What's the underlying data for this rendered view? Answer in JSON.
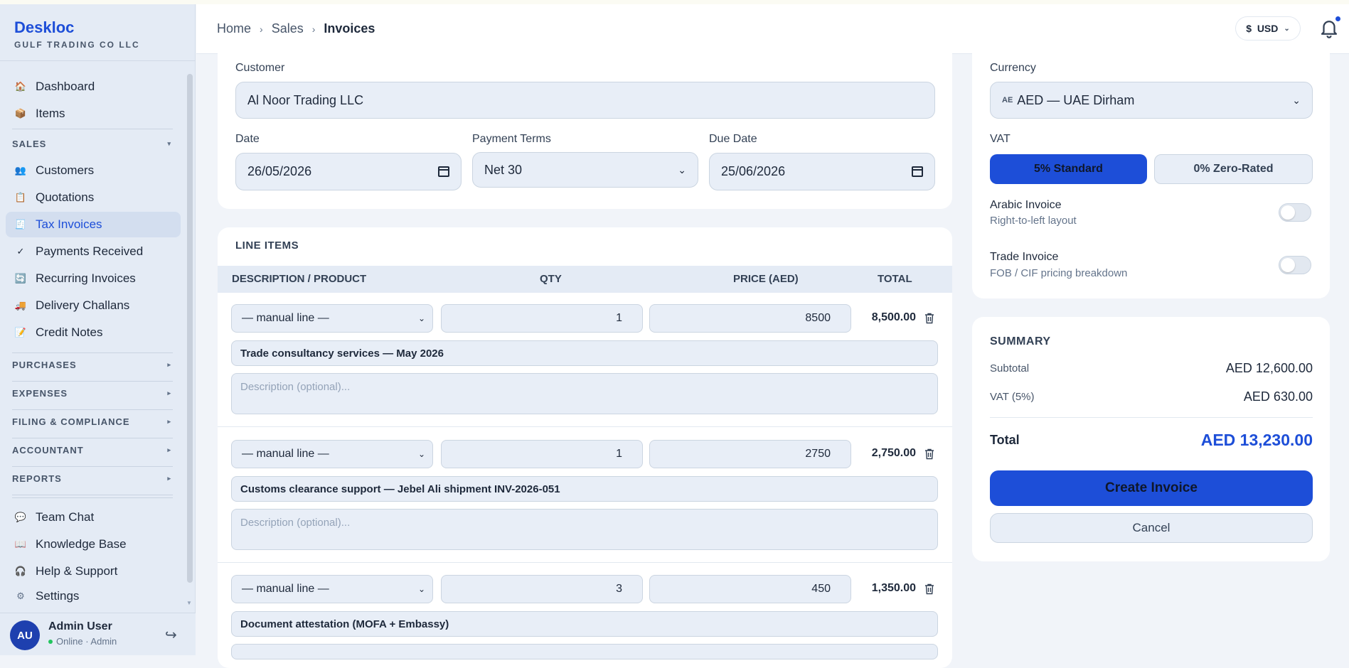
{
  "brand": {
    "name": "Deskloc",
    "company": "GULF TRADING CO LLC"
  },
  "sidebar": {
    "top_items": [
      {
        "label": "Dashboard",
        "icon": "house-icon"
      },
      {
        "label": "Items",
        "icon": "box-icon"
      }
    ],
    "sales_header": "SALES",
    "sales_items": [
      {
        "label": "Customers",
        "icon": "people-icon"
      },
      {
        "label": "Quotations",
        "icon": "clipboard-icon"
      },
      {
        "label": "Tax Invoices",
        "icon": "receipt-icon",
        "active": true
      },
      {
        "label": "Payments Received",
        "icon": "check-icon"
      },
      {
        "label": "Recurring Invoices",
        "icon": "repeat-icon"
      },
      {
        "label": "Delivery Challans",
        "icon": "truck-icon"
      },
      {
        "label": "Credit Notes",
        "icon": "note-icon"
      }
    ],
    "sections": [
      "PURCHASES",
      "EXPENSES",
      "FILING & COMPLIANCE",
      "ACCOUNTANT",
      "REPORTS"
    ],
    "bottom_items": [
      {
        "label": "Team Chat",
        "icon": "chat-icon"
      },
      {
        "label": "Knowledge Base",
        "icon": "book-icon"
      },
      {
        "label": "Help & Support",
        "icon": "headset-icon"
      },
      {
        "label": "Settings",
        "icon": "gear-icon"
      }
    ],
    "user": {
      "initials": "AU",
      "name": "Admin User",
      "status": "Online · Admin"
    }
  },
  "header": {
    "breadcrumb": [
      "Home",
      "Sales",
      "Invoices"
    ],
    "currency_symbol": "$",
    "currency_code": "USD"
  },
  "form": {
    "customer_label": "Customer",
    "customer_value": "Al Noor Trading LLC",
    "date_label": "Date",
    "date_value": "26/05/2026",
    "terms_label": "Payment Terms",
    "terms_value": "Net 30",
    "due_label": "Due Date",
    "due_value": "25/06/2026"
  },
  "line_items": {
    "title": "LINE ITEMS",
    "columns": [
      "DESCRIPTION / PRODUCT",
      "QTY",
      "PRICE (AED)",
      "TOTAL"
    ],
    "desc_placeholder": "Description (optional)...",
    "rows": [
      {
        "product": "— manual line —",
        "qty": "1",
        "price": "8500",
        "total": "8,500.00",
        "name": "Trade consultancy services — May 2026"
      },
      {
        "product": "— manual line —",
        "qty": "1",
        "price": "2750",
        "total": "2,750.00",
        "name": "Customs clearance support — Jebel Ali shipment INV-2026-051"
      },
      {
        "product": "— manual line —",
        "qty": "3",
        "price": "450",
        "total": "1,350.00",
        "name": "Document attestation (MOFA + Embassy)"
      }
    ]
  },
  "settings": {
    "currency_label": "Currency",
    "currency_flag": "AE",
    "currency_value": "AED — UAE Dirham",
    "vat_label": "VAT",
    "vat_options": [
      "5% Standard",
      "0% Zero-Rated"
    ],
    "arabic_title": "Arabic Invoice",
    "arabic_sub": "Right-to-left layout",
    "trade_title": "Trade Invoice",
    "trade_sub": "FOB / CIF pricing breakdown"
  },
  "summary": {
    "title": "SUMMARY",
    "subtotal_label": "Subtotal",
    "subtotal_value": "AED 12,600.00",
    "vat_label": "VAT (5%)",
    "vat_value": "AED 630.00",
    "total_label": "Total",
    "total_value": "AED 13,230.00",
    "create_label": "Create Invoice",
    "cancel_label": "Cancel"
  },
  "colors": {
    "accent": "#1d4ed8",
    "sidebar_bg": "#e4ebf5",
    "page_bg": "#f1f4f9"
  }
}
